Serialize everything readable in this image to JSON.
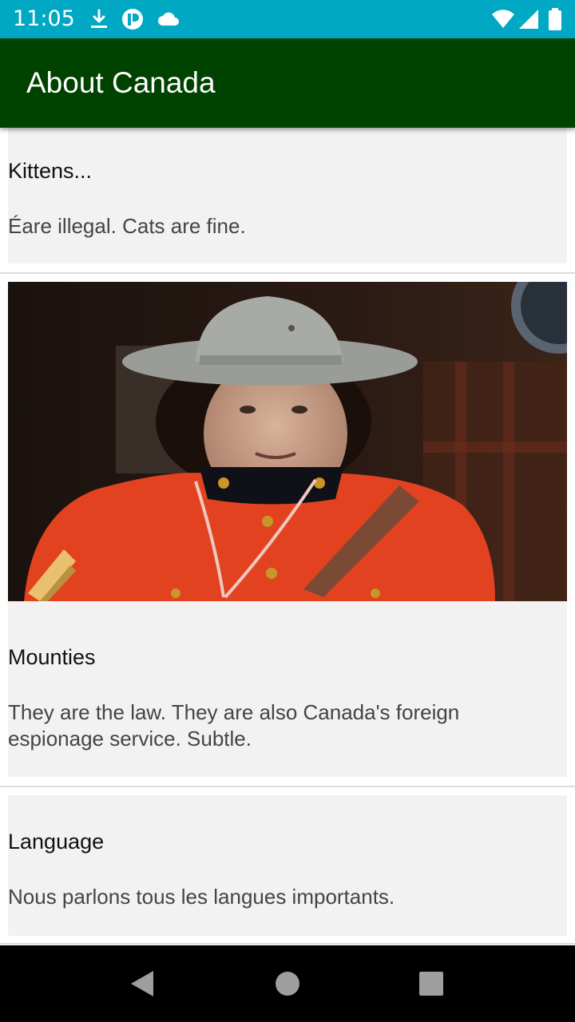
{
  "status_bar": {
    "time": "11:05",
    "left_icons": [
      "download-icon",
      "app-notification-icon",
      "cloud-icon"
    ],
    "right_icons": [
      "wifi-icon",
      "cellular-signal-icon",
      "battery-icon"
    ]
  },
  "app_bar": {
    "title": "About Canada",
    "color": "#004200"
  },
  "cards": [
    {
      "title": "Kittens...",
      "body": "Éare illegal. Cats are fine."
    },
    {
      "image": "mountie-photo",
      "title": "Mounties",
      "body": "They are the law. They are also Canada's foreign espionage service. Subtle."
    },
    {
      "title": "Language",
      "body": "Nous parlons tous les langues importants."
    }
  ],
  "nav_bar": {
    "buttons": [
      "back-icon",
      "home-icon",
      "recents-icon"
    ]
  },
  "colors": {
    "status_bar": "#00a8c4",
    "app_bar": "#004200",
    "card_background": "#f2f2f2"
  }
}
